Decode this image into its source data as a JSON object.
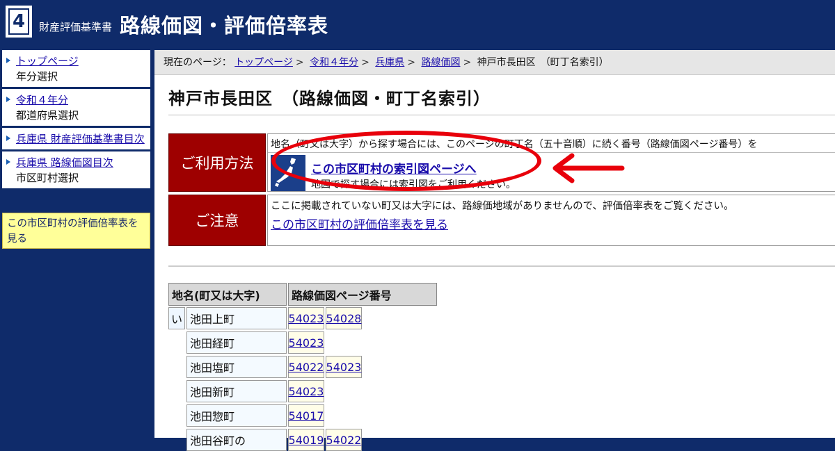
{
  "header": {
    "logo_number": "4",
    "subtitle": "財産評価基準書",
    "title": "路線価図・評価倍率表"
  },
  "sidebar": {
    "items": [
      {
        "link": "トップページ",
        "desc": "年分選択"
      },
      {
        "link": "令和４年分",
        "desc": "都道府県選択"
      },
      {
        "link": "兵庫県 財産評価基準書目次",
        "desc": ""
      },
      {
        "link": "兵庫県 路線価図目次",
        "desc": "市区町村選択"
      }
    ],
    "highlight": "この市区町村の評価倍率表を見る"
  },
  "breadcrumb": {
    "prefix": "現在のページ：",
    "links": [
      "トップページ",
      "令和４年分",
      "兵庫県",
      "路線価図"
    ],
    "current": "神戸市長田区　（町丁名索引）"
  },
  "page_title": "神戸市長田区　（路線価図・町丁名索引）",
  "usage": {
    "label": "ご利用方法",
    "text1": "地名（町又は大字）から探す場合には、このページの町丁名（五十音順）に続く番号（路線価図ページ番号）を",
    "link": "この市区町村の索引図ページへ",
    "text2": "地図で探す場合には索引図をご利用ください。"
  },
  "caution": {
    "label": "ご注意",
    "text": "ここに掲載されていない町又は大字には、路線価地域がありませんので、評価倍率表をご覧ください。",
    "link": "この市区町村の評価倍率表を見る"
  },
  "table": {
    "header_name": "地名(町又は大字)",
    "header_pages": "路線価図ページ番号",
    "kana": "い",
    "rows": [
      {
        "name": "池田上町",
        "pages": [
          "54023",
          "54028"
        ]
      },
      {
        "name": "池田経町",
        "pages": [
          "54023"
        ]
      },
      {
        "name": "池田塩町",
        "pages": [
          "54022",
          "54023"
        ]
      },
      {
        "name": "池田新町",
        "pages": [
          "54023"
        ]
      },
      {
        "name": "池田惣町",
        "pages": [
          "54017"
        ]
      },
      {
        "name": "池田谷町の",
        "pages": [
          "54019",
          "54022"
        ]
      }
    ]
  },
  "colors": {
    "header_bg": "#0f2b6a",
    "label_bg": "#9e0000",
    "annotation_red": "#e8000b",
    "highlight_bg": "#ffff99"
  }
}
